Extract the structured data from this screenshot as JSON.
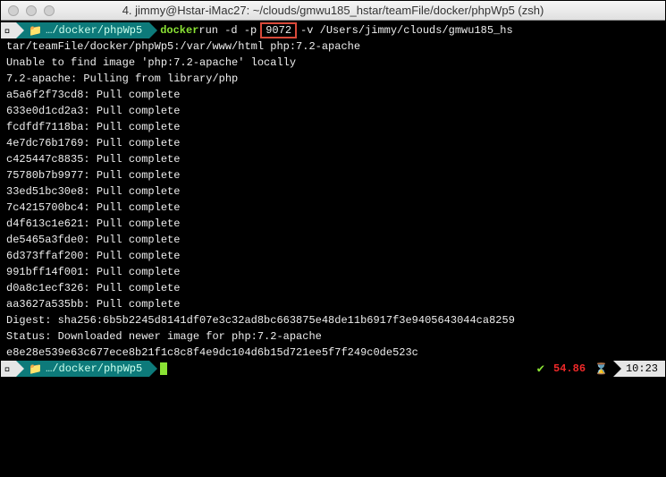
{
  "titlebar": {
    "title": "4. jimmy@Hstar-iMac27: ~/clouds/gmwu185_hstar/teamFile/docker/phpWp5 (zsh)"
  },
  "prompt": {
    "apple": "",
    "folder": "📁",
    "path": "…/docker/phpWp5",
    "cmd_docker": "docker",
    "cmd_part1": " run -d -p",
    "cmd_highlight": "9072",
    "cmd_part2": "-v /Users/jimmy/clouds/gmwu185_hs"
  },
  "wrap": "tar/teamFile/docker/phpWp5:/var/www/html php:7.2-apache",
  "output": [
    "Unable to find image 'php:7.2-apache' locally",
    "7.2-apache: Pulling from library/php",
    "a5a6f2f73cd8: Pull complete",
    "633e0d1cd2a3: Pull complete",
    "fcdfdf7118ba: Pull complete",
    "4e7dc76b1769: Pull complete",
    "c425447c8835: Pull complete",
    "75780b7b9977: Pull complete",
    "33ed51bc30e8: Pull complete",
    "7c4215700bc4: Pull complete",
    "d4f613c1e621: Pull complete",
    "de5465a3fde0: Pull complete",
    "6d373ffaf200: Pull complete",
    "991bff14f001: Pull complete",
    "d0a8c1ecf326: Pull complete",
    "aa3627a535bb: Pull complete",
    "Digest: sha256:6b5b2245d8141df07e3c32ad8bc663875e48de11b6917f3e9405643044ca8259",
    "Status: Downloaded newer image for php:7.2-apache",
    "e8e28e539e63c677ece8b21f1c8c8f4e9dc104d6b15d721ee5f7f249c0de523c"
  ],
  "status": {
    "check": "✔",
    "percent": "54.86",
    "hourglass": "⌛",
    "time": "10:23"
  }
}
